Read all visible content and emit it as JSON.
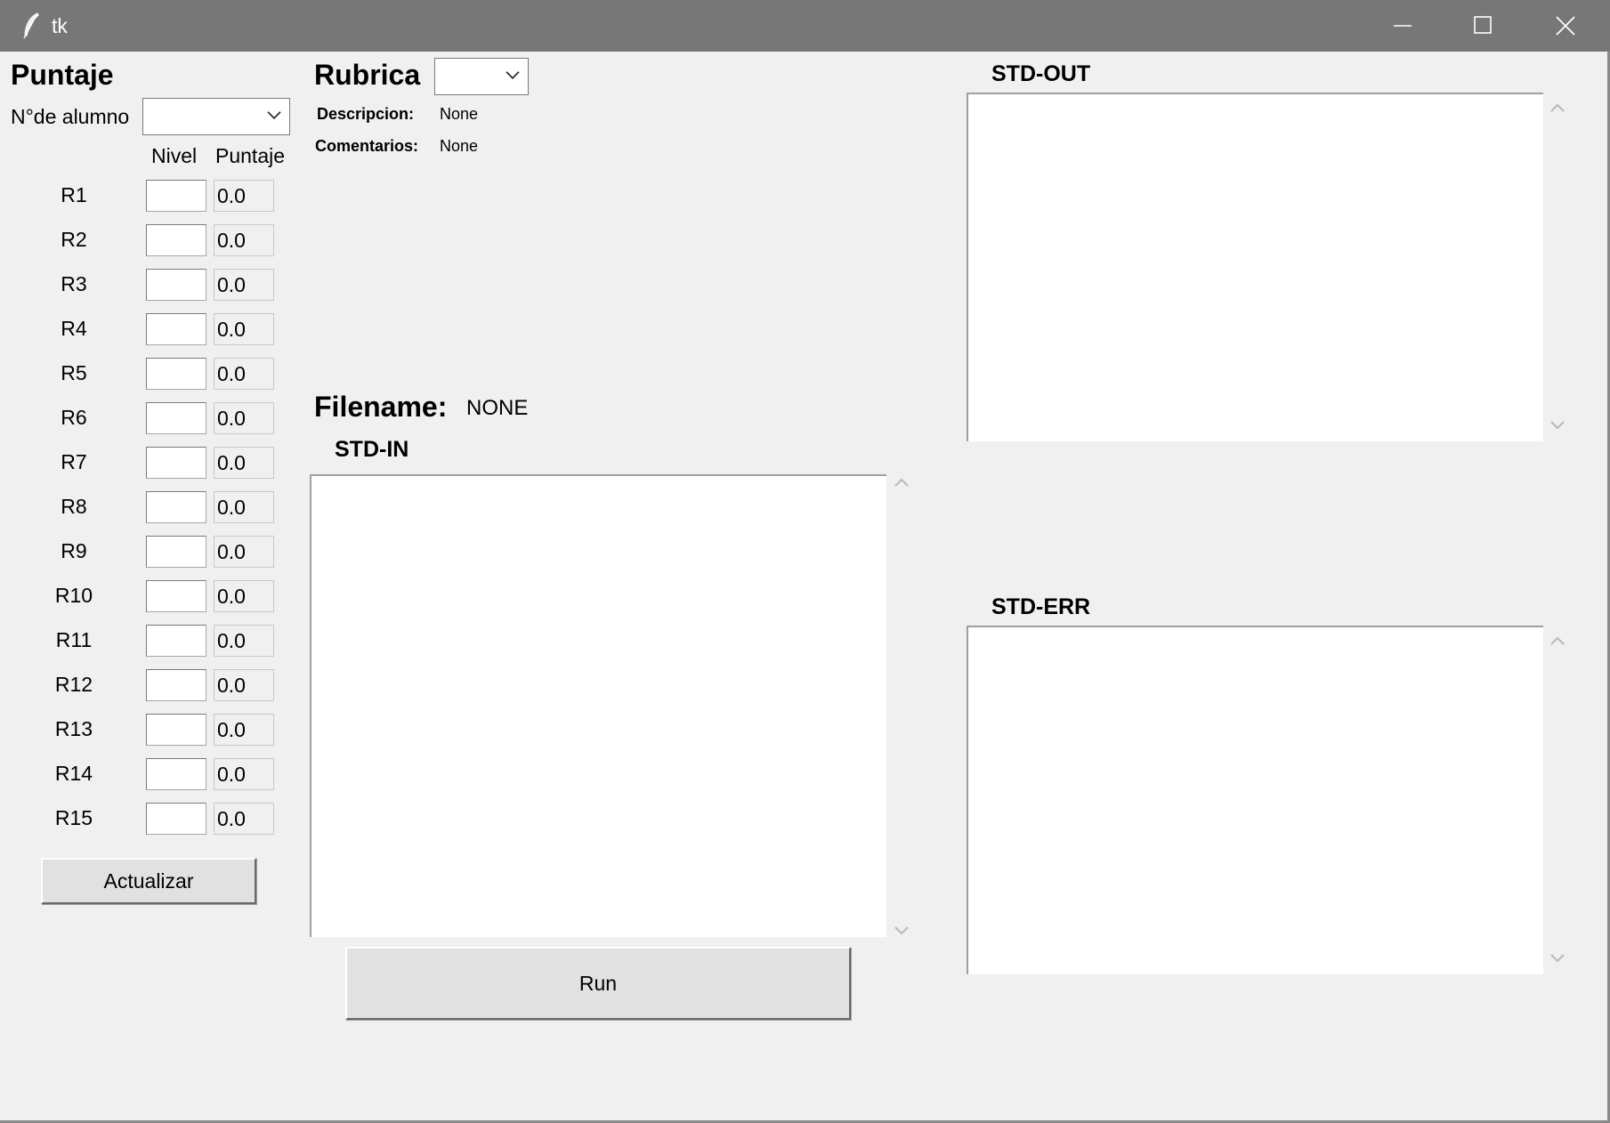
{
  "window": {
    "title": "tk"
  },
  "puntaje": {
    "heading": "Puntaje",
    "alumno_label": "N°de alumno",
    "alumno_value": "",
    "col_nivel": "Nivel",
    "col_puntaje": "Puntaje",
    "rows": [
      {
        "label": "R1",
        "nivel": "",
        "puntaje": "0.0"
      },
      {
        "label": "R2",
        "nivel": "",
        "puntaje": "0.0"
      },
      {
        "label": "R3",
        "nivel": "",
        "puntaje": "0.0"
      },
      {
        "label": "R4",
        "nivel": "",
        "puntaje": "0.0"
      },
      {
        "label": "R5",
        "nivel": "",
        "puntaje": "0.0"
      },
      {
        "label": "R6",
        "nivel": "",
        "puntaje": "0.0"
      },
      {
        "label": "R7",
        "nivel": "",
        "puntaje": "0.0"
      },
      {
        "label": "R8",
        "nivel": "",
        "puntaje": "0.0"
      },
      {
        "label": "R9",
        "nivel": "",
        "puntaje": "0.0"
      },
      {
        "label": "R10",
        "nivel": "",
        "puntaje": "0.0"
      },
      {
        "label": "R11",
        "nivel": "",
        "puntaje": "0.0"
      },
      {
        "label": "R12",
        "nivel": "",
        "puntaje": "0.0"
      },
      {
        "label": "R13",
        "nivel": "",
        "puntaje": "0.0"
      },
      {
        "label": "R14",
        "nivel": "",
        "puntaje": "0.0"
      },
      {
        "label": "R15",
        "nivel": "",
        "puntaje": "0.0"
      }
    ],
    "update_button": "Actualizar"
  },
  "rubrica": {
    "heading": "Rubrica",
    "selected": "",
    "descripcion_label": "Descripcion:",
    "descripcion_value": "None",
    "comentarios_label": "Comentarios:",
    "comentarios_value": "None"
  },
  "file": {
    "label": "Filename:",
    "value": "NONE"
  },
  "std_in": {
    "label": "STD-IN",
    "content": ""
  },
  "std_out": {
    "label": "STD-OUT",
    "content": ""
  },
  "std_err": {
    "label": "STD-ERR",
    "content": ""
  },
  "run_button": "Run",
  "icons": {
    "app": "feather-icon",
    "minimize": "minimize-icon",
    "maximize": "maximize-icon",
    "close": "close-icon",
    "dropdown": "chevron-down-icon",
    "scroll_up": "chevron-up-icon",
    "scroll_down": "chevron-down-icon"
  },
  "colors": {
    "titlebar": "#777777",
    "background": "#f0f0f0",
    "field": "#ffffff"
  }
}
